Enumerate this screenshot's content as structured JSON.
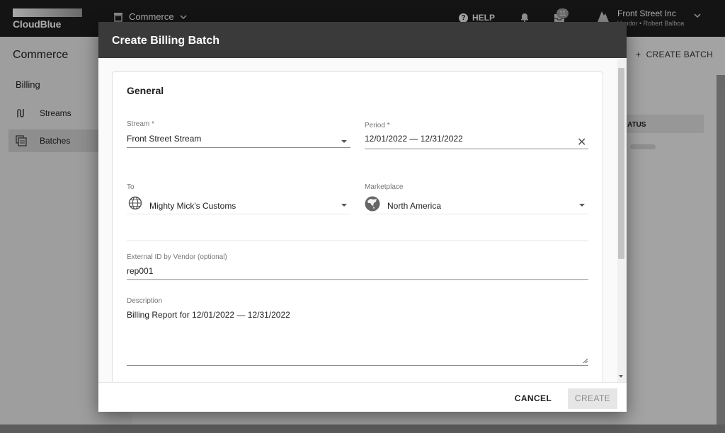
{
  "topbar": {
    "logo_text": "CloudBlue",
    "app_switcher_label": "Commerce",
    "help_label": "HELP",
    "notifications_count": "11",
    "account_name": "Front Street Inc",
    "account_role": "Vendor • Robert Balboa"
  },
  "sidebar": {
    "title": "Commerce",
    "section": "Billing",
    "items": [
      {
        "label": "Streams",
        "icon": "streams-icon"
      },
      {
        "label": "Batches",
        "icon": "batches-icon"
      }
    ]
  },
  "main": {
    "create_batch_label": "CREATE BATCH",
    "table_status_header": "ATUS"
  },
  "dialog": {
    "title": "Create Billing Batch",
    "card_title": "General",
    "stream": {
      "label": "Stream *",
      "value": "Front Street Stream"
    },
    "period": {
      "label": "Period *",
      "value": "12/01/2022 — 12/31/2022"
    },
    "to": {
      "label": "To",
      "value": "Mighty Mick's Customs",
      "icon": "globe-icon"
    },
    "marketplace": {
      "label": "Marketplace",
      "value": "North America",
      "icon": "north-america-icon"
    },
    "external_id": {
      "label": "External ID by Vendor (optional)",
      "value": "rep001"
    },
    "description": {
      "label": "Description",
      "value": "Billing Report for 12/01/2022 — 12/31/2022"
    },
    "cancel_label": "CANCEL",
    "create_label": "CREATE"
  },
  "colors": {
    "header_bg": "#3a3a3a",
    "topbar_bg": "#1f1f1f"
  }
}
